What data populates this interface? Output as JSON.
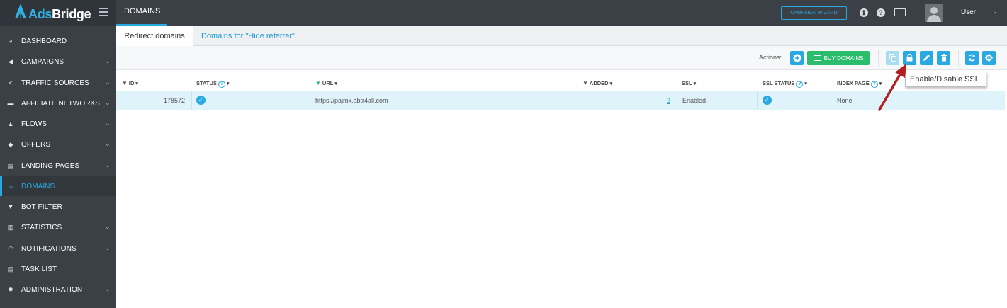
{
  "header": {
    "logo_ads": "Ads",
    "logo_bridge": "Bridge",
    "page_title": "DOMAINS",
    "campaign_wizard": "CAMPAIGN WIZARD",
    "user": "User",
    "info_icon": "ℹ",
    "help_icon": "?"
  },
  "sidebar": {
    "items": [
      {
        "label": "DASHBOARD",
        "icon": "dashboard-icon",
        "chevron": false
      },
      {
        "label": "CAMPAIGNS",
        "icon": "megaphone-icon",
        "chevron": true
      },
      {
        "label": "TRAFFIC SOURCES",
        "icon": "share-icon",
        "chevron": true
      },
      {
        "label": "AFFILIATE NETWORKS",
        "icon": "briefcase-icon",
        "chevron": true
      },
      {
        "label": "FLOWS",
        "icon": "sitemap-icon",
        "chevron": true
      },
      {
        "label": "OFFERS",
        "icon": "tags-icon",
        "chevron": true
      },
      {
        "label": "LANDING PAGES",
        "icon": "list-icon",
        "chevron": true
      },
      {
        "label": "DOMAINS",
        "icon": "link-icon",
        "chevron": false,
        "active": true
      },
      {
        "label": "BOT FILTER",
        "icon": "filter-icon",
        "chevron": false
      },
      {
        "label": "STATISTICS",
        "icon": "bar-chart-icon",
        "chevron": true
      },
      {
        "label": "NOTIFICATIONS",
        "icon": "bell-icon",
        "chevron": true
      },
      {
        "label": "TASK LIST",
        "icon": "task-list-icon",
        "chevron": false
      },
      {
        "label": "ADMINISTRATION",
        "icon": "gear-icon",
        "chevron": true
      }
    ]
  },
  "tabs": {
    "redirect": "Redirect domains",
    "hide_referrer": "Domains for \"Hide referrer\""
  },
  "actions": {
    "label": "Actions:",
    "buy_domains": "BUY DOMAINS",
    "tooltip": "Enable/Disable SSL"
  },
  "table": {
    "headers": {
      "id": "ID",
      "status": "STATUS",
      "url": "URL",
      "added": "ADDED",
      "ssl": "SSL",
      "ssl_status": "SSL STATUS",
      "index_page": "INDEX PAGE"
    },
    "rows": [
      {
        "id": "178572",
        "url": "https://pajmx.abtr4all.com",
        "added": "2",
        "ssl": "Enabled",
        "index_page": "None"
      }
    ]
  },
  "colors": {
    "accent": "#29a9e1",
    "green": "#2bbd6c",
    "sidebar_bg": "#3a4046",
    "row_highlight": "#dff3fb",
    "arrow": "#b32020"
  }
}
